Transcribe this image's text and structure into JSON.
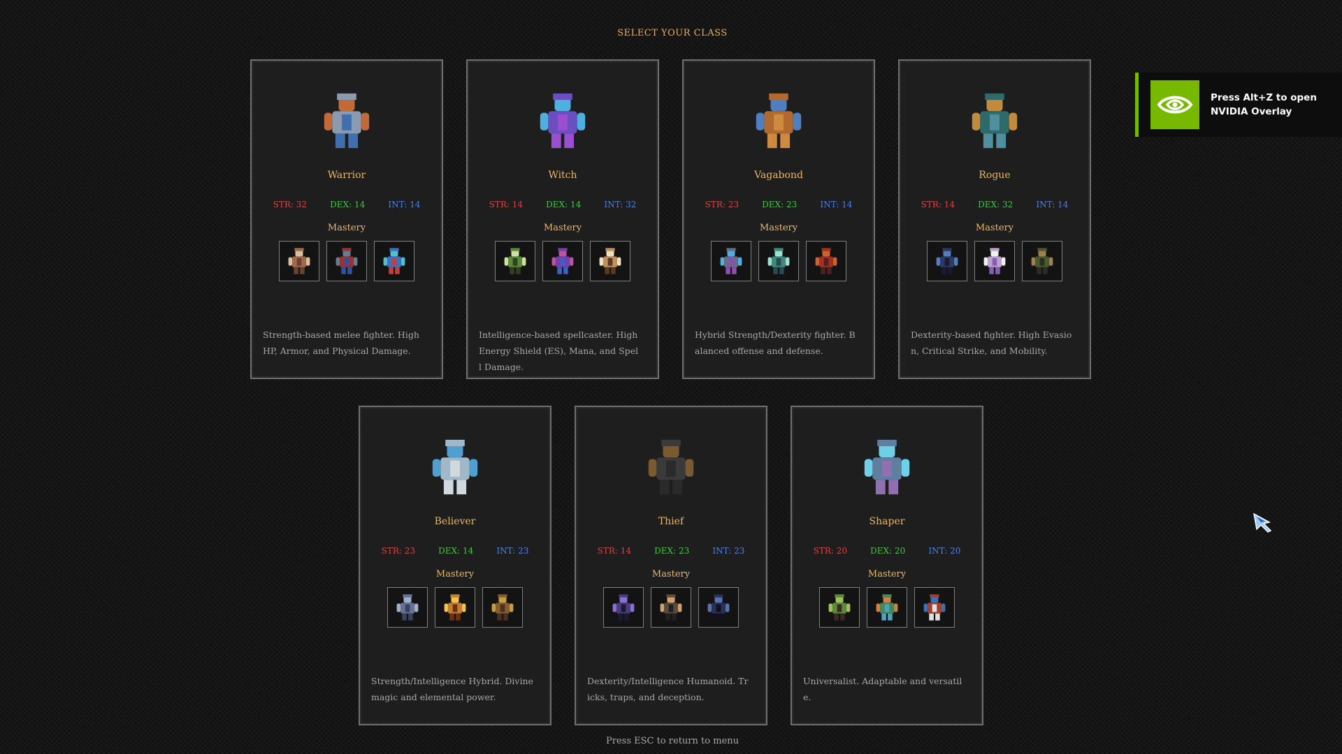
{
  "screen": {
    "title": "SELECT YOUR CLASS",
    "footer_hint": "Press ESC to return to menu"
  },
  "colors": {
    "name": "#e8b86a",
    "str": "#d94545",
    "dex": "#47c447",
    "int": "#4f7fe0",
    "description": "#a8a8a8",
    "nvidia_green": "#76b900"
  },
  "mastery_label": "Mastery",
  "classes": [
    {
      "name": "Warrior",
      "portrait_icon": "armored-knight-portrait",
      "str": "STR: 32",
      "dex": "DEX: 14",
      "int": "INT: 14",
      "masteries": [
        "barbarian-icon",
        "red-knight-icon",
        "paladin-icon"
      ],
      "description": "Strength-based melee fighter. High HP, Armor, and Physical Damage."
    },
    {
      "name": "Witch",
      "portrait_icon": "witch-portrait",
      "str": "STR: 14",
      "dex": "DEX: 14",
      "int": "INT: 32",
      "masteries": [
        "druid-icon",
        "sorceress-icon",
        "scholar-icon"
      ],
      "description": "Intelligence-based spellcaster. High Energy Shield (ES), Mana, and Spell Damage."
    },
    {
      "name": "Vagabond",
      "portrait_icon": "vagabond-portrait",
      "str": "STR: 23",
      "dex": "DEX: 23",
      "int": "INT: 14",
      "masteries": [
        "spellblade-icon",
        "hooded-mystic-icon",
        "samurai-icon"
      ],
      "description": "Hybrid Strength/Dexterity fighter. Balanced offense and defense."
    },
    {
      "name": "Rogue",
      "portrait_icon": "rogue-portrait",
      "str": "STR: 14",
      "dex": "DEX: 32",
      "int": "INT: 14",
      "masteries": [
        "assassin-icon",
        "dancer-icon",
        "ranger-icon"
      ],
      "description": "Dexterity-based fighter. High Evasion, Critical Strike, and Mobility."
    },
    {
      "name": "Believer",
      "portrait_icon": "believer-portrait",
      "str": "STR: 23",
      "dex": "DEX: 14",
      "int": "INT: 23",
      "masteries": [
        "monk-icon",
        "fire-priest-icon",
        "shaman-icon"
      ],
      "description": "Strength/Intelligence Hybrid. Divine magic and elemental power."
    },
    {
      "name": "Thief",
      "portrait_icon": "thief-portrait",
      "str": "STR: 14",
      "dex": "DEX: 23",
      "int": "INT: 23",
      "masteries": [
        "shadow-mage-icon",
        "bandit-icon",
        "phantom-icon"
      ],
      "description": "Dexterity/Intelligence Humanoid. Tricks, traps, and deception."
    },
    {
      "name": "Shaper",
      "portrait_icon": "shaper-portrait",
      "str": "STR: 20",
      "dex": "DEX: 20",
      "int": "INT: 20",
      "masteries": [
        "goblin-icon",
        "golem-icon",
        "swordsman-icon"
      ],
      "description": "Universalist. Adaptable and versatile."
    }
  ],
  "overlay": {
    "logo_icon": "nvidia-logo-icon",
    "line1": "Press Alt+Z to open",
    "line2": "NVIDIA Overlay"
  }
}
